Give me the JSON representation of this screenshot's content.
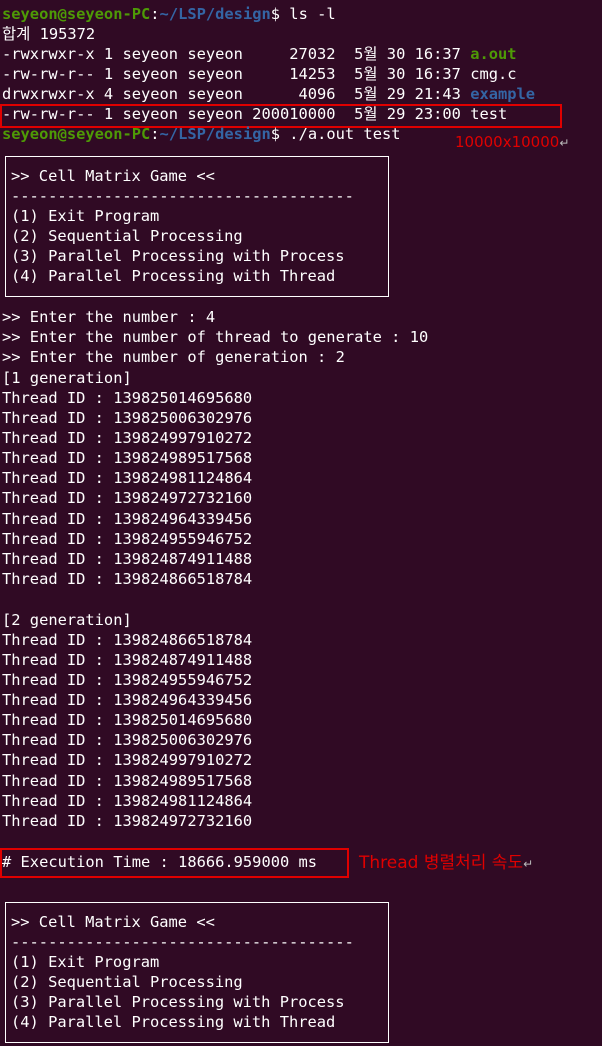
{
  "prompt1": {
    "user": "seyeon@seyeon-PC",
    "sep": ":",
    "path": "~/LSP/design",
    "symbol": "$ ",
    "cmd": "ls -l"
  },
  "total_line": "합계 195372",
  "ls_rows": [
    {
      "meta": "-rwxrwxr-x 1 seyeon seyeon     27032  5월 30 16:37 ",
      "name": "a.out",
      "kind": "exec"
    },
    {
      "meta": "-rw-rw-r-- 1 seyeon seyeon     14253  5월 30 16:37 ",
      "name": "cmg.c",
      "kind": "file"
    },
    {
      "meta": "drwxrwxr-x 4 seyeon seyeon      4096  5월 29 21:43 ",
      "name": "example",
      "kind": "dir"
    },
    {
      "meta": "-rw-rw-r-- 1 seyeon seyeon 200010000  5월 29 23:00 ",
      "name": "test",
      "kind": "file"
    }
  ],
  "prompt2": {
    "user": "seyeon@seyeon-PC",
    "sep": ":",
    "path": "~/LSP/design",
    "symbol": "$ ",
    "cmd": "./a.out test"
  },
  "annotation_size": "10000x10000",
  "annotation_thread": "Thread  병렬처리  속도",
  "return_mark": "↵",
  "menu": {
    "title": ">> Cell Matrix Game <<",
    "divider": "-------------------------------------",
    "items": [
      "(1) Exit Program",
      "(2) Sequential Processing",
      "(3) Parallel Processing with Process",
      "(4) Parallel Processing with Thread"
    ]
  },
  "inputs": [
    ">> Enter the number : 4",
    ">> Enter the number of thread to generate : 10",
    ">> Enter the number of generation : 2"
  ],
  "generations": [
    {
      "header": "[1 generation]",
      "threads": [
        "Thread ID : 139825014695680",
        "Thread ID : 139825006302976",
        "Thread ID : 139824997910272",
        "Thread ID : 139824989517568",
        "Thread ID : 139824981124864",
        "Thread ID : 139824972732160",
        "Thread ID : 139824964339456",
        "Thread ID : 139824955946752",
        "Thread ID : 139824874911488",
        "Thread ID : 139824866518784"
      ]
    },
    {
      "header": "[2 generation]",
      "threads": [
        "Thread ID : 139824866518784",
        "Thread ID : 139824874911488",
        "Thread ID : 139824955946752",
        "Thread ID : 139824964339456",
        "Thread ID : 139825014695680",
        "Thread ID : 139825006302976",
        "Thread ID : 139824997910272",
        "Thread ID : 139824989517568",
        "Thread ID : 139824981124864",
        "Thread ID : 139824972732160"
      ]
    }
  ],
  "execution_time": "# Execution Time : 18666.959000 ms",
  "colors": {
    "background": "#300a24",
    "prompt_user": "#4e9a06",
    "prompt_path": "#3465a4",
    "highlight_box": "#e00000",
    "text": "#ffffff"
  }
}
